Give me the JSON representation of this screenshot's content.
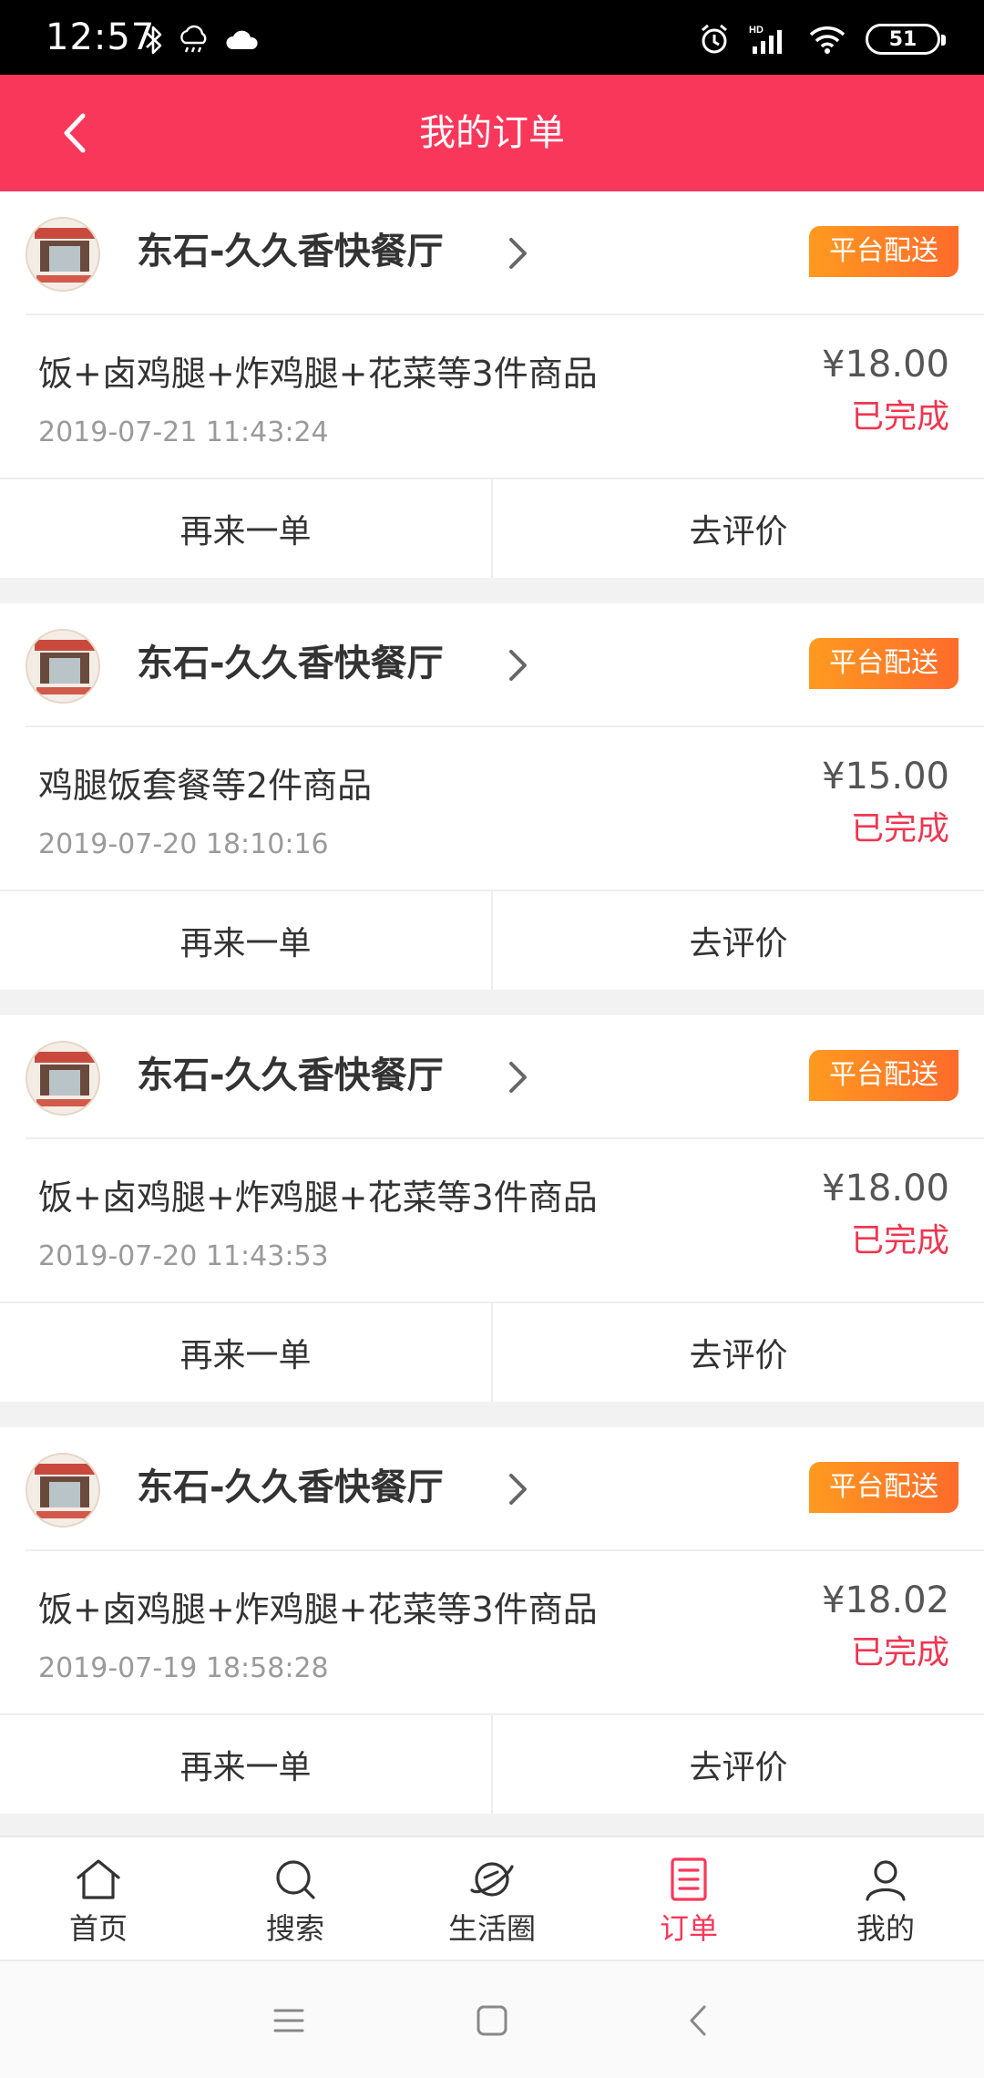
{
  "status_bar": {
    "time": "12:57",
    "battery_level": "51",
    "icons": [
      "bluetooth-icon",
      "weather-rain-icon",
      "cloud-icon",
      "alarm-icon",
      "hd-signal-icon",
      "wifi-icon",
      "battery-icon"
    ]
  },
  "header": {
    "title": "我的订单",
    "back_icon": "back-chevron-icon"
  },
  "orders": [
    {
      "store_name": "东石-久久香快餐厅",
      "badge": "平台配送",
      "items": "饭+卤鸡腿+炸鸡腿+花菜等3件商品",
      "time": "2019-07-21 11:43:24",
      "price": "¥18.00",
      "status": "已完成",
      "reorder_label": "再来一单",
      "review_label": "去评价"
    },
    {
      "store_name": "东石-久久香快餐厅",
      "badge": "平台配送",
      "items": "鸡腿饭套餐等2件商品",
      "time": "2019-07-20 18:10:16",
      "price": "¥15.00",
      "status": "已完成",
      "reorder_label": "再来一单",
      "review_label": "去评价"
    },
    {
      "store_name": "东石-久久香快餐厅",
      "badge": "平台配送",
      "items": "饭+卤鸡腿+炸鸡腿+花菜等3件商品",
      "time": "2019-07-20 11:43:53",
      "price": "¥18.00",
      "status": "已完成",
      "reorder_label": "再来一单",
      "review_label": "去评价"
    },
    {
      "store_name": "东石-久久香快餐厅",
      "badge": "平台配送",
      "items": "饭+卤鸡腿+炸鸡腿+花菜等3件商品",
      "time": "2019-07-19 18:58:28",
      "price": "¥18.02",
      "status": "已完成",
      "reorder_label": "再来一单",
      "review_label": "去评价"
    }
  ],
  "bottom_nav": [
    {
      "label": "首页",
      "icon": "home-icon",
      "active": false
    },
    {
      "label": "搜索",
      "icon": "search-icon",
      "active": false
    },
    {
      "label": "生活圈",
      "icon": "planet-icon",
      "active": false
    },
    {
      "label": "订单",
      "icon": "order-list-icon",
      "active": true
    },
    {
      "label": "我的",
      "icon": "profile-icon",
      "active": false
    }
  ],
  "colors": {
    "brand": "#f9375a",
    "badge_start": "#ff9a1f",
    "badge_end": "#ff6b2c",
    "status_complete": "#ef3651"
  }
}
